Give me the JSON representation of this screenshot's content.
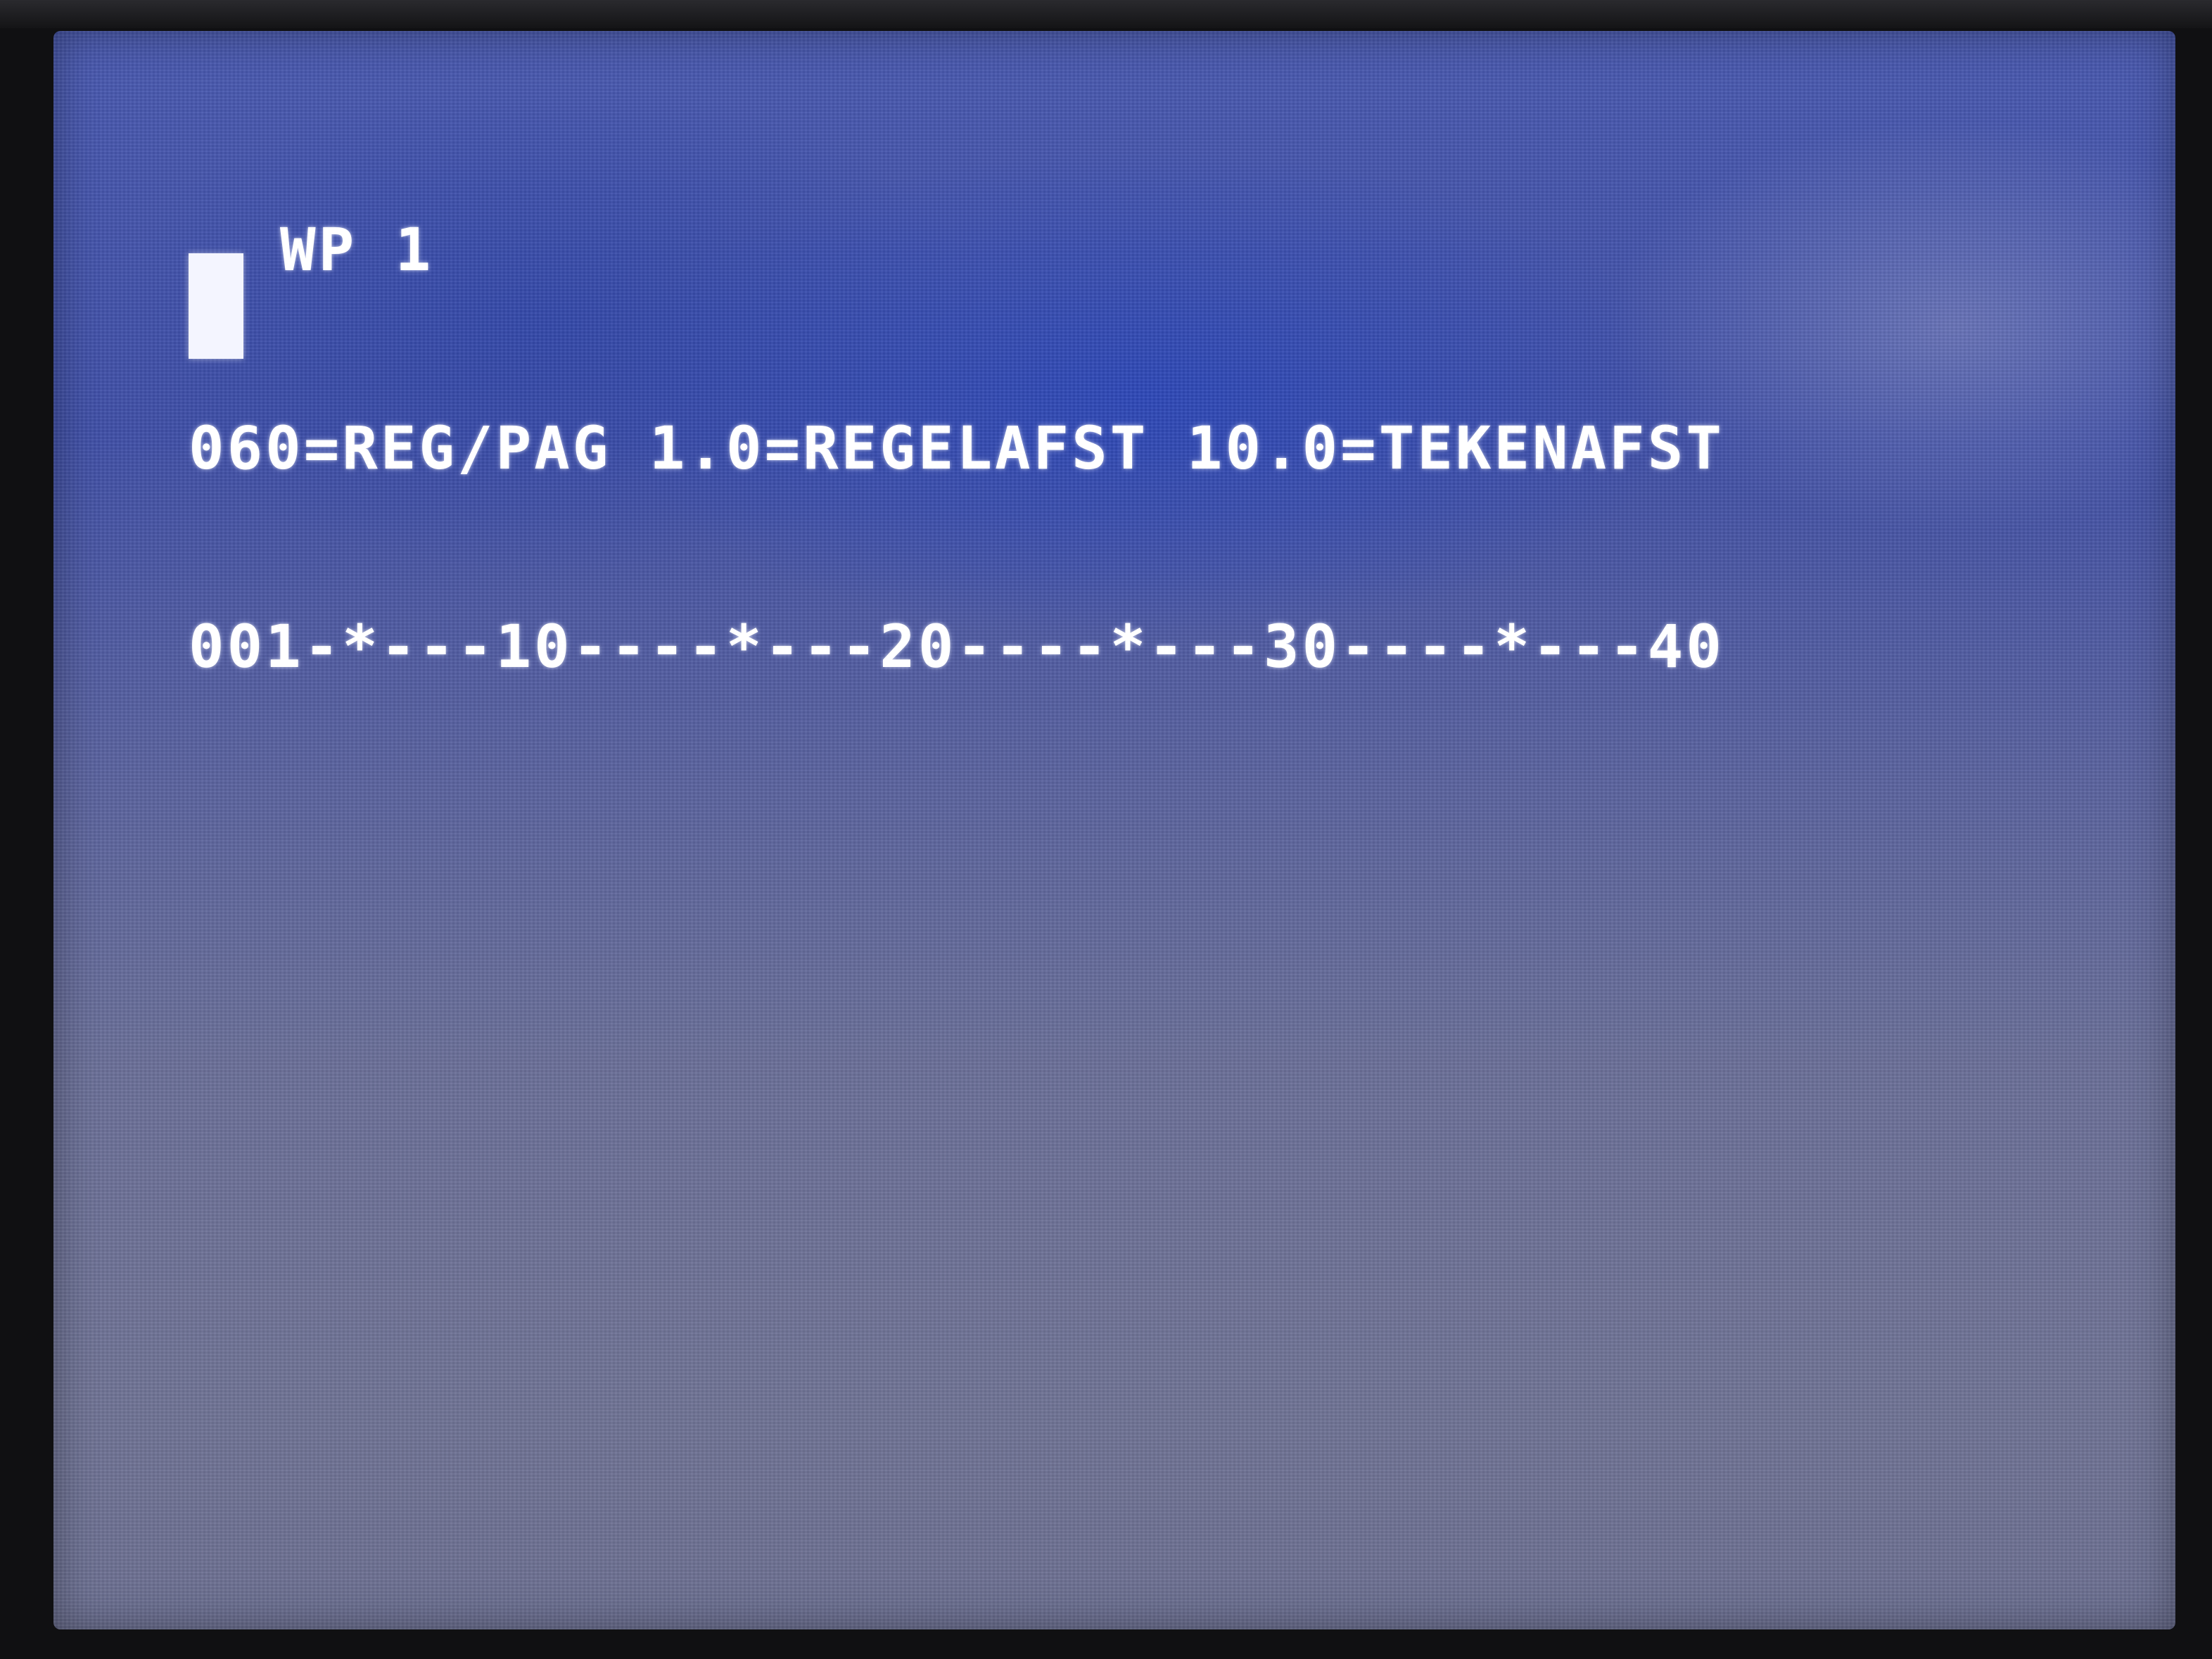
{
  "screen": {
    "title": "WP 1",
    "status_line": "060=REG/PAG 1.0=REGELAFST 10.0=TEKENAFST",
    "ruler": "001-*---10----*---20----*---30----*---40"
  },
  "colors": {
    "background": "#4a5ab0",
    "text": "#ffffff"
  }
}
